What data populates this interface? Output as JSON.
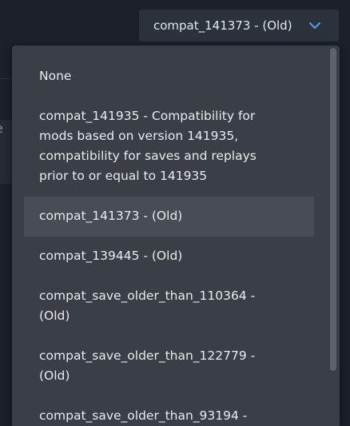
{
  "select": {
    "value": "compat_141373 - (Old)",
    "icon": "chevron-down-icon",
    "accent": "#4f9fe6"
  },
  "background": {
    "partial_letter": "e"
  },
  "dropdown": {
    "options": [
      {
        "label": "None"
      },
      {
        "label": "compat_141935 - Compatibility for\nmods based on version 141935,\ncompatibility for saves and replays\nprior to or equal to 141935"
      },
      {
        "label": "compat_141373 - (Old)",
        "selected": true
      },
      {
        "label": "compat_139445 - (Old)"
      },
      {
        "label": "compat_save_older_than_110364 -\n(Old)"
      },
      {
        "label": "compat_save_older_than_122779 -\n(Old)"
      },
      {
        "label": "compat_save_older_than_93194 -"
      }
    ]
  }
}
